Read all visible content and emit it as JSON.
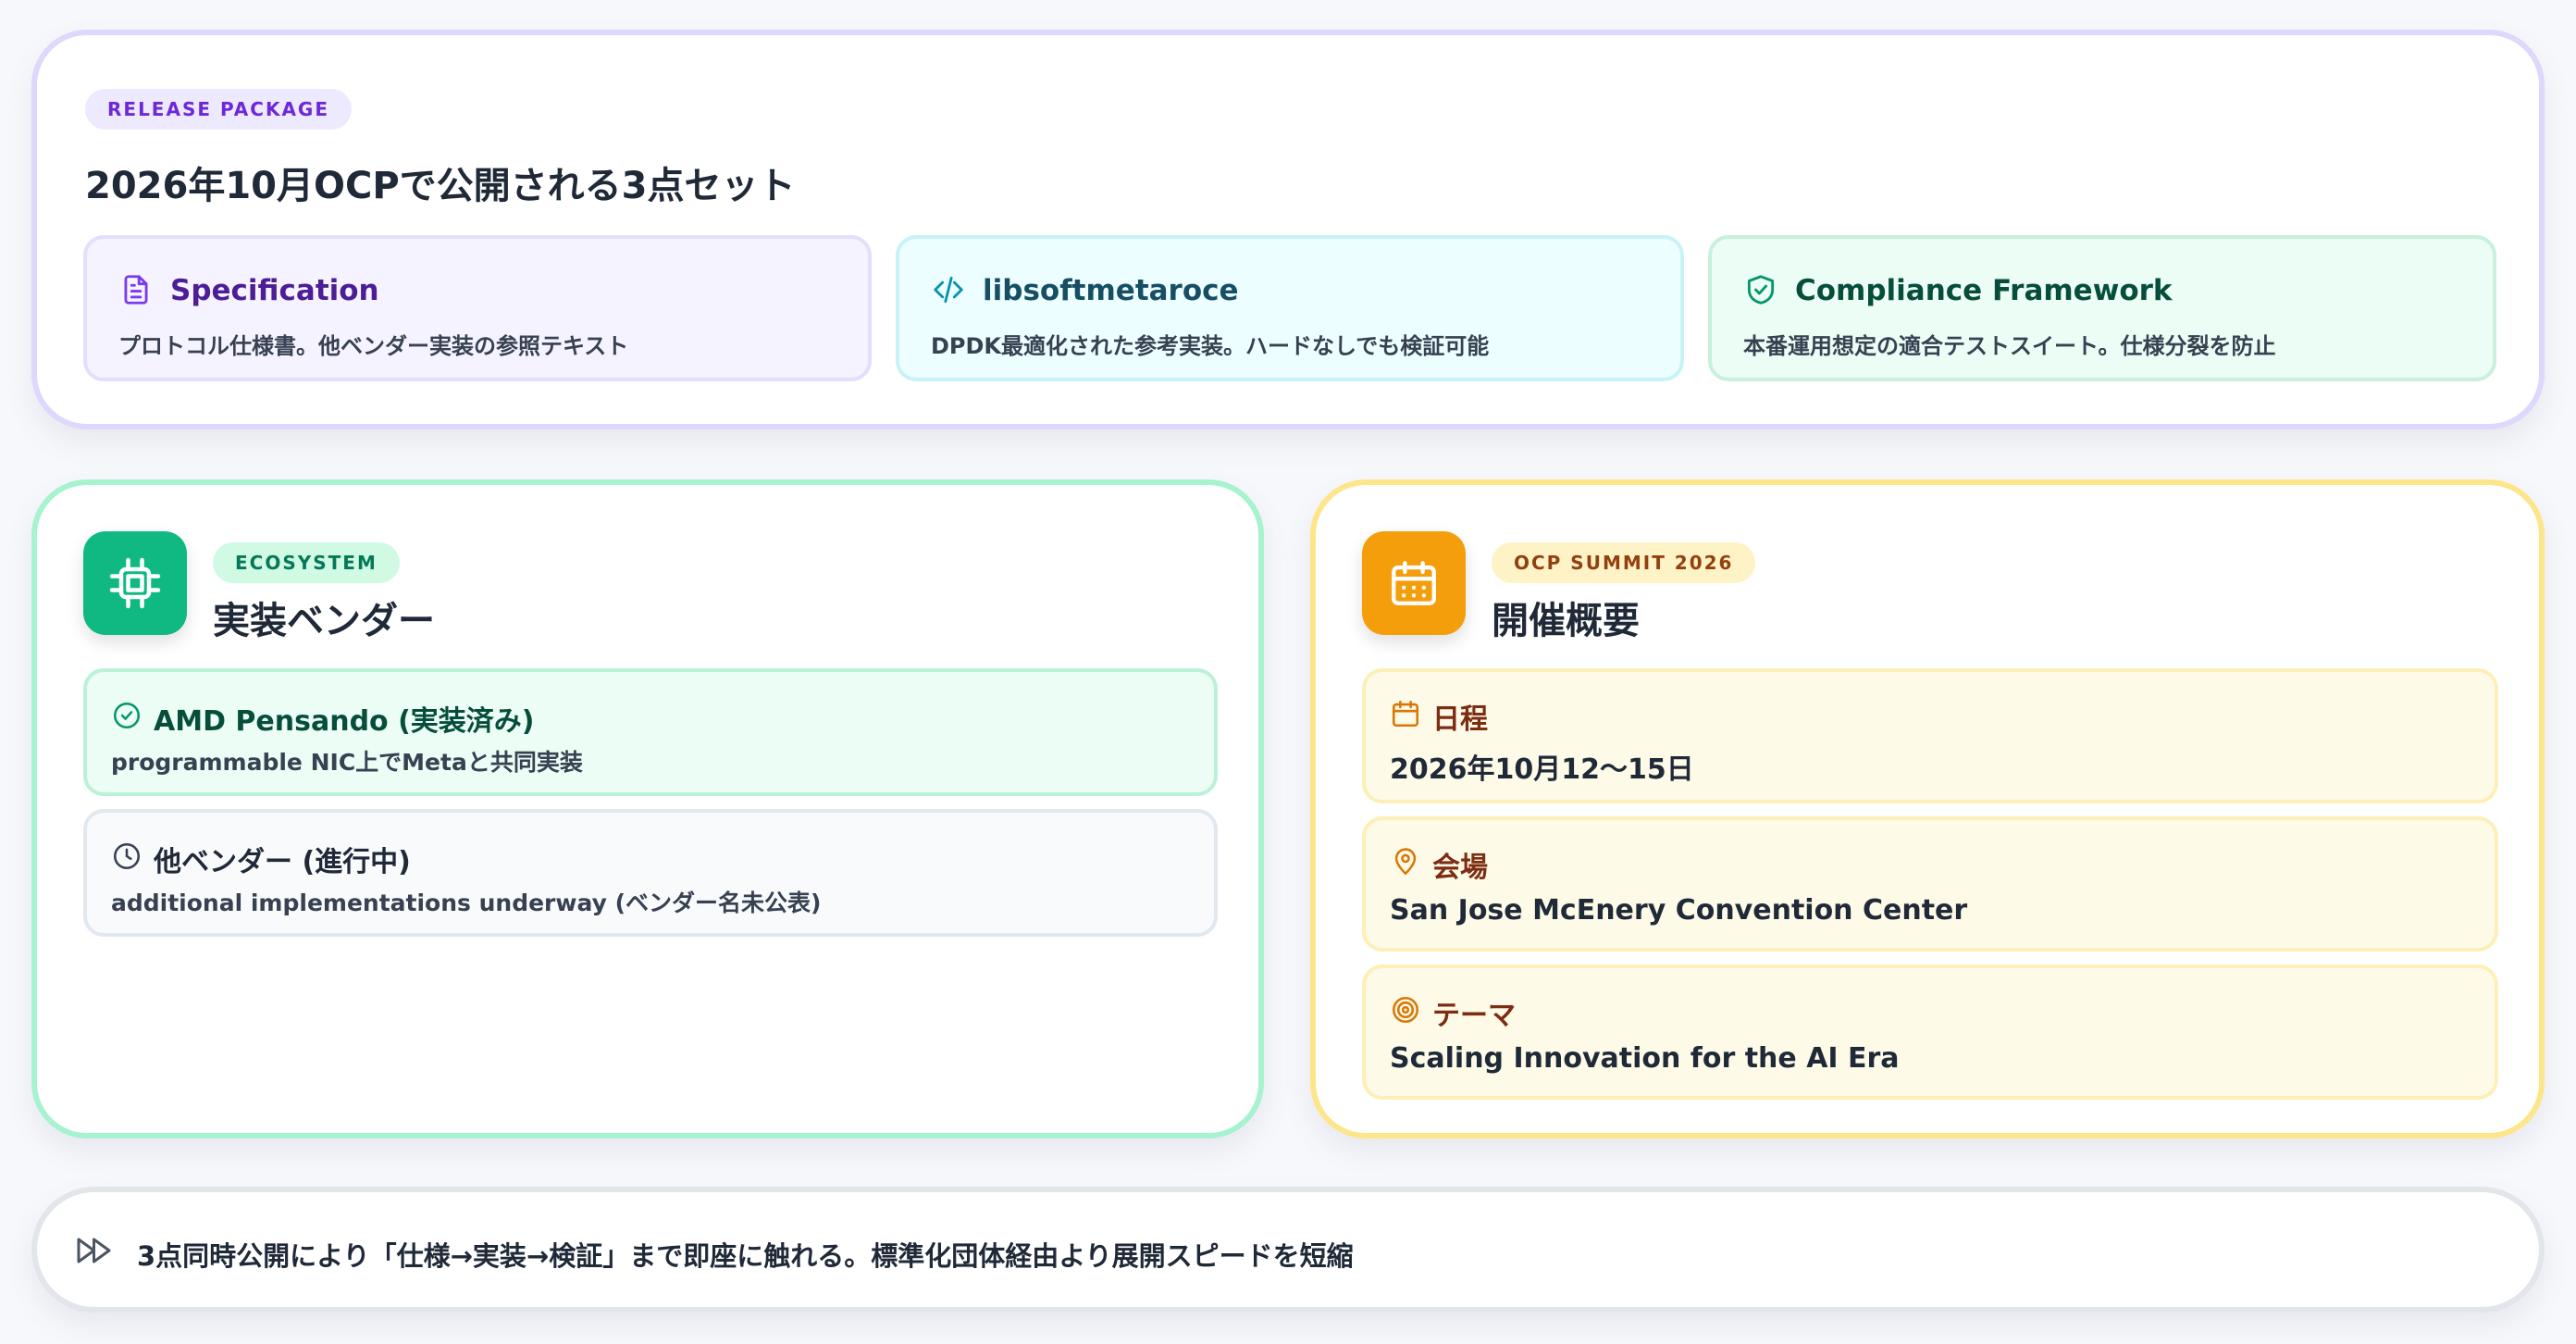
{
  "release": {
    "tag": "RELEASE PACKAGE",
    "title": "2026年10月OCPで公開される3点セット",
    "packages": [
      {
        "icon": "document-icon",
        "title": "Specification",
        "desc": "プロトコル仕様書。他ベンダー実装の参照テキスト",
        "accent": "#7c3aed"
      },
      {
        "icon": "code-icon",
        "title": "libsoftmetaroce",
        "desc": "DPDK最適化された参考実装。ハードなしでも検証可能",
        "accent": "#0891b2"
      },
      {
        "icon": "shield-check-icon",
        "title": "Compliance Framework",
        "desc": "本番運用想定の適合テストスイート。仕様分裂を防止",
        "accent": "#059669"
      }
    ]
  },
  "vendors": {
    "tag": "ECOSYSTEM",
    "title": "実装ベンダー",
    "icon": "chip-icon",
    "items": [
      {
        "icon": "check-circle-icon",
        "title": "AMD Pensando (実装済み)",
        "desc": "programmable NIC上でMetaと共同実装"
      },
      {
        "icon": "clock-icon",
        "title": "他ベンダー (進行中)",
        "desc": "additional implementations underway (ベンダー名未公表)"
      }
    ]
  },
  "summit": {
    "tag": "OCP SUMMIT 2026",
    "title": "開催概要",
    "icon": "calendar-icon",
    "items": [
      {
        "icon": "calendar-icon",
        "label": "日程",
        "value": "2026年10月12〜15日"
      },
      {
        "icon": "map-pin-icon",
        "label": "会場",
        "value": "San Jose McEnery Convention Center"
      },
      {
        "icon": "target-icon",
        "label": "テーマ",
        "value": "Scaling Innovation for the AI Era"
      }
    ]
  },
  "banner": {
    "icon": "fast-forward-icon",
    "text": "3点同時公開により「仕様→実装→検証」まで即座に触れる。標準化団体経由より展開スピードを短縮"
  },
  "colors": {
    "purple": "#7c3aed",
    "cyan": "#0891b2",
    "green": "#10b981",
    "amber": "#f59e0b"
  }
}
